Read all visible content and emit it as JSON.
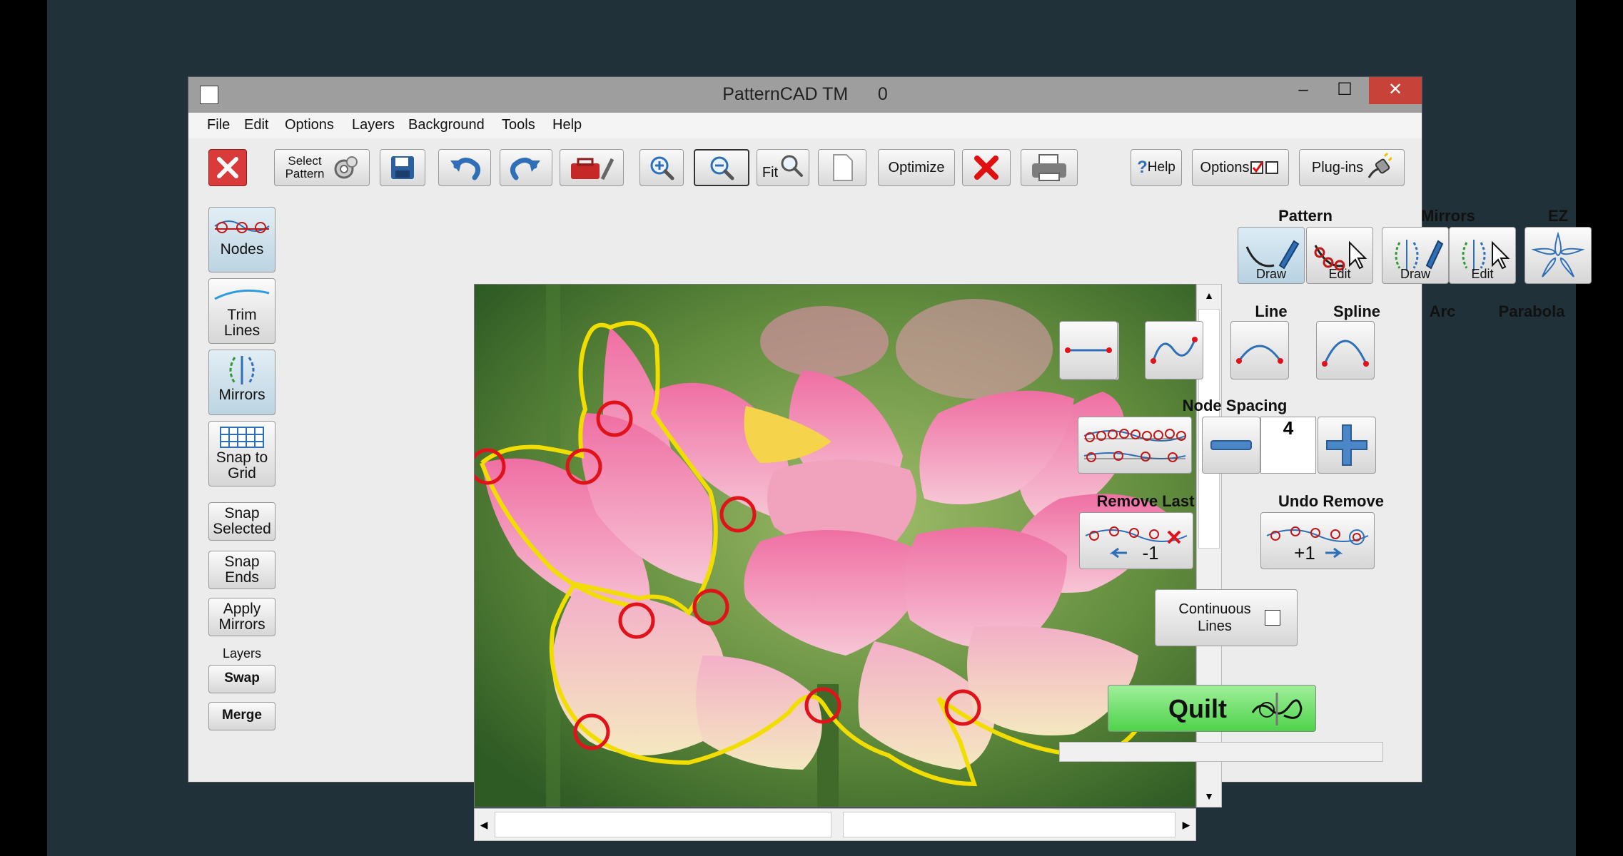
{
  "window": {
    "title": "PatternCAD TM",
    "title_count": "0",
    "controls": {
      "minimize": "–",
      "maximize": "☐",
      "close": "✕"
    }
  },
  "menu": [
    "File",
    "Edit",
    "Options",
    "Layers",
    "Background",
    "Tools",
    "Help"
  ],
  "toolbar": {
    "select_pattern_line1": "Select",
    "select_pattern_line2": "Pattern",
    "fit": "Fit",
    "optimize": "Optimize",
    "help": "Help",
    "options": "Options",
    "plugins": "Plug-ins"
  },
  "left_tools": {
    "nodes": "Nodes",
    "trim_lines": "Trim Lines",
    "mirrors": "Mirrors",
    "snap_to_grid": "Snap to Grid",
    "snap_selected": "Snap Selected",
    "snap_ends": "Snap Ends",
    "apply_mirrors": "Apply Mirrors",
    "layers_label": "Layers",
    "swap": "Swap",
    "merge": "Merge"
  },
  "right_panel": {
    "pattern": {
      "heading": "Pattern",
      "draw": "Draw",
      "edit": "Edit"
    },
    "mirrors": {
      "heading": "Mirrors",
      "draw": "Draw",
      "edit": "Edit"
    },
    "ez": {
      "heading": "EZ"
    },
    "line": "Line",
    "spline": "Spline",
    "arc": "Arc",
    "parabola": "Parabola",
    "node_spacing": {
      "heading": "Node Spacing",
      "value": "4"
    },
    "remove_last": {
      "heading": "Remove Last",
      "badge": "-1"
    },
    "undo_remove": {
      "heading": "Undo Remove",
      "badge": "+1"
    },
    "continuous_lines": {
      "label": "Continuous Lines",
      "checked": false
    },
    "quilt": "Quilt"
  },
  "colors": {
    "accent_blue": "#2f6fb7",
    "node_red": "#e0121a",
    "outline_yellow": "#f2dd00",
    "quilt_green": "#5ad654"
  }
}
